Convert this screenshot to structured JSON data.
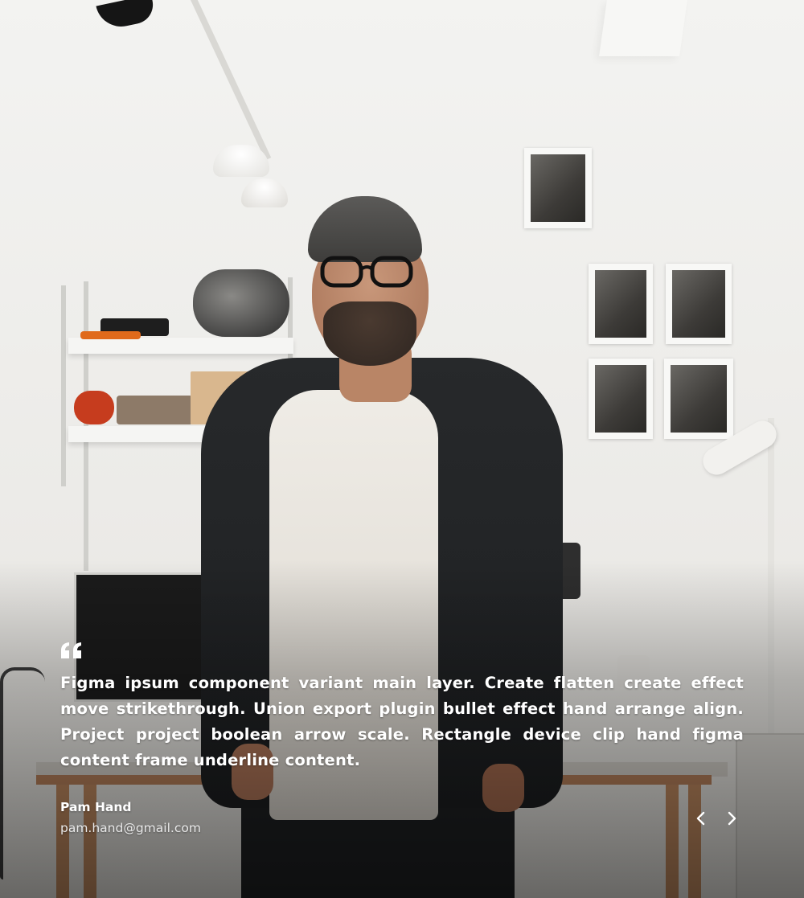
{
  "testimonial": {
    "quote": "Figma ipsum component variant main layer. Create flatten create effect move strikethrough. Union export plugin bullet effect hand arrange align. Project project boolean arrow scale. Rectangle device clip hand figma content frame underline content.",
    "author_name": "Pam Hand",
    "author_email": "pam.hand@gmail.com",
    "quote_icon": "quote-icon",
    "prev_icon": "chevron-left-icon",
    "next_icon": "chevron-right-icon",
    "text_color": "#ffffff"
  }
}
